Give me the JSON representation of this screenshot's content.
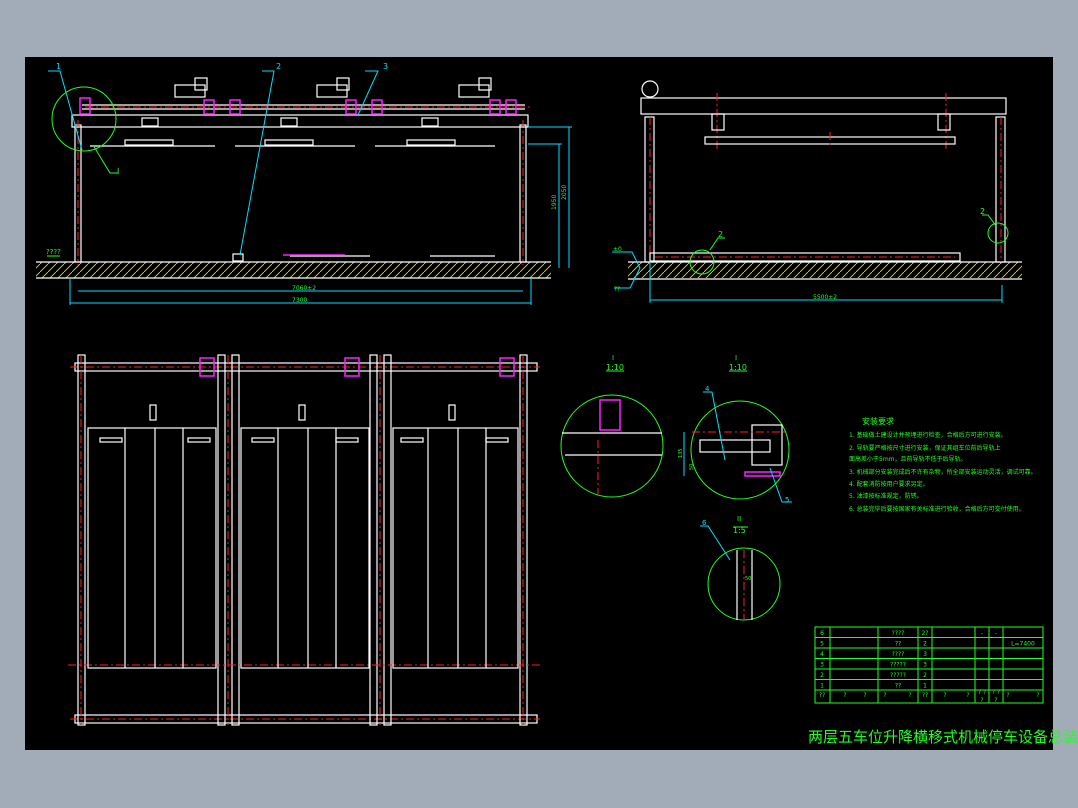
{
  "colors": {
    "viewer_background": "#a2acb8",
    "drawing_background": "#000000",
    "annotation": "#20ff20",
    "leader": "#00e0ff",
    "centerline": "#ff2020",
    "outline": "#ffffff",
    "hatch": "#e8e800",
    "highlight": "#ff20ff"
  },
  "front_view": {
    "callouts": [
      "1",
      "2",
      "3",
      "I"
    ],
    "ground_label": "????",
    "dim_inner_width": "7060±2",
    "dim_outer_width": "7300",
    "dim_height_1": "1950",
    "dim_height_2": "2050"
  },
  "side_view": {
    "callouts": [
      "2",
      "2"
    ],
    "level_label_top": "±0",
    "level_label_bottom": "??",
    "dim_width": "5500±2"
  },
  "details": [
    {
      "mark": "I",
      "scale": "1:10"
    },
    {
      "mark": "I",
      "scale": "1:10",
      "callouts": [
        "4",
        "5"
      ],
      "dim_a": "135",
      "dim_b": "50"
    },
    {
      "mark": "II",
      "scale": "1:5",
      "callouts": [
        "6"
      ],
      "dim": "50"
    }
  ],
  "notes": {
    "title": "安装要求",
    "items": [
      "1. 基础做土建设计并预埋进行检查，合格后方可进行安装。",
      "2. 导轨要严格按尺寸进行安装，保证其组车位前后导轨上",
      "   面高差小于5mm，且前导轨不低于后导轨。",
      "3. 机械部分安装完成后不许有杂物，所全部安装运动灵活，调试可靠。",
      "4. 配套消防按用户要求另定。",
      "5. 油漆按标准规定，防锈。",
      "6. 总装完毕后要按国家有关标准进行验收，合格后方可交付使用。"
    ]
  },
  "parts_table": {
    "rows": [
      {
        "no": "6",
        "name": "????",
        "qty": "2?",
        "c1": "-",
        "c2": "-",
        "remark": ""
      },
      {
        "no": "5",
        "name": "??",
        "qty": "2",
        "c1": "",
        "c2": "",
        "remark": "L=7400"
      },
      {
        "no": "4",
        "name": "????",
        "qty": "3",
        "c1": "",
        "c2": "",
        "remark": ""
      },
      {
        "no": "3",
        "name": "?????",
        "qty": "3",
        "c1": "",
        "c2": "",
        "remark": ""
      },
      {
        "no": "2",
        "name": "?????",
        "qty": "2",
        "c1": "",
        "c2": "",
        "remark": ""
      },
      {
        "no": "1",
        "name": "??",
        "qty": "1",
        "c1": "",
        "c2": "",
        "remark": ""
      }
    ],
    "header": [
      "??",
      "?",
      "?",
      "?",
      "?",
      "??",
      "?",
      "?",
      "? ?",
      "? ?",
      "?",
      "?",
      "?",
      "?"
    ]
  },
  "title_block": {
    "title": "两层五车位升降横移式机械停车设备总装图"
  }
}
